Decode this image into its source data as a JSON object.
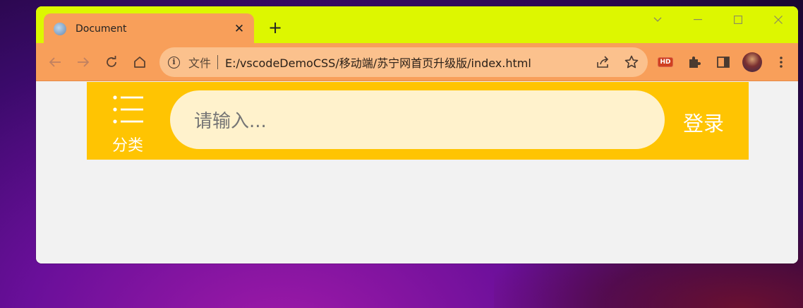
{
  "browser": {
    "tab": {
      "title": "Document",
      "close": "✕"
    },
    "new_tab": "+",
    "controls": {
      "dropdown": "⌵",
      "minimize": "—",
      "maximize": "☐",
      "close": "✕"
    },
    "omnibox": {
      "label": "文件",
      "url": "E:/vscodeDemoCSS/移动端/苏宁网首页升级版/index.html"
    },
    "extension_badge": "HD"
  },
  "page": {
    "classify_label": "分类",
    "search_placeholder": "请输入...",
    "login_label": "登录"
  },
  "colors": {
    "titlebar": "#ddf700",
    "toolbar": "#f89f5a",
    "header": "#ffc402",
    "search_bg": "#fff2cc"
  }
}
